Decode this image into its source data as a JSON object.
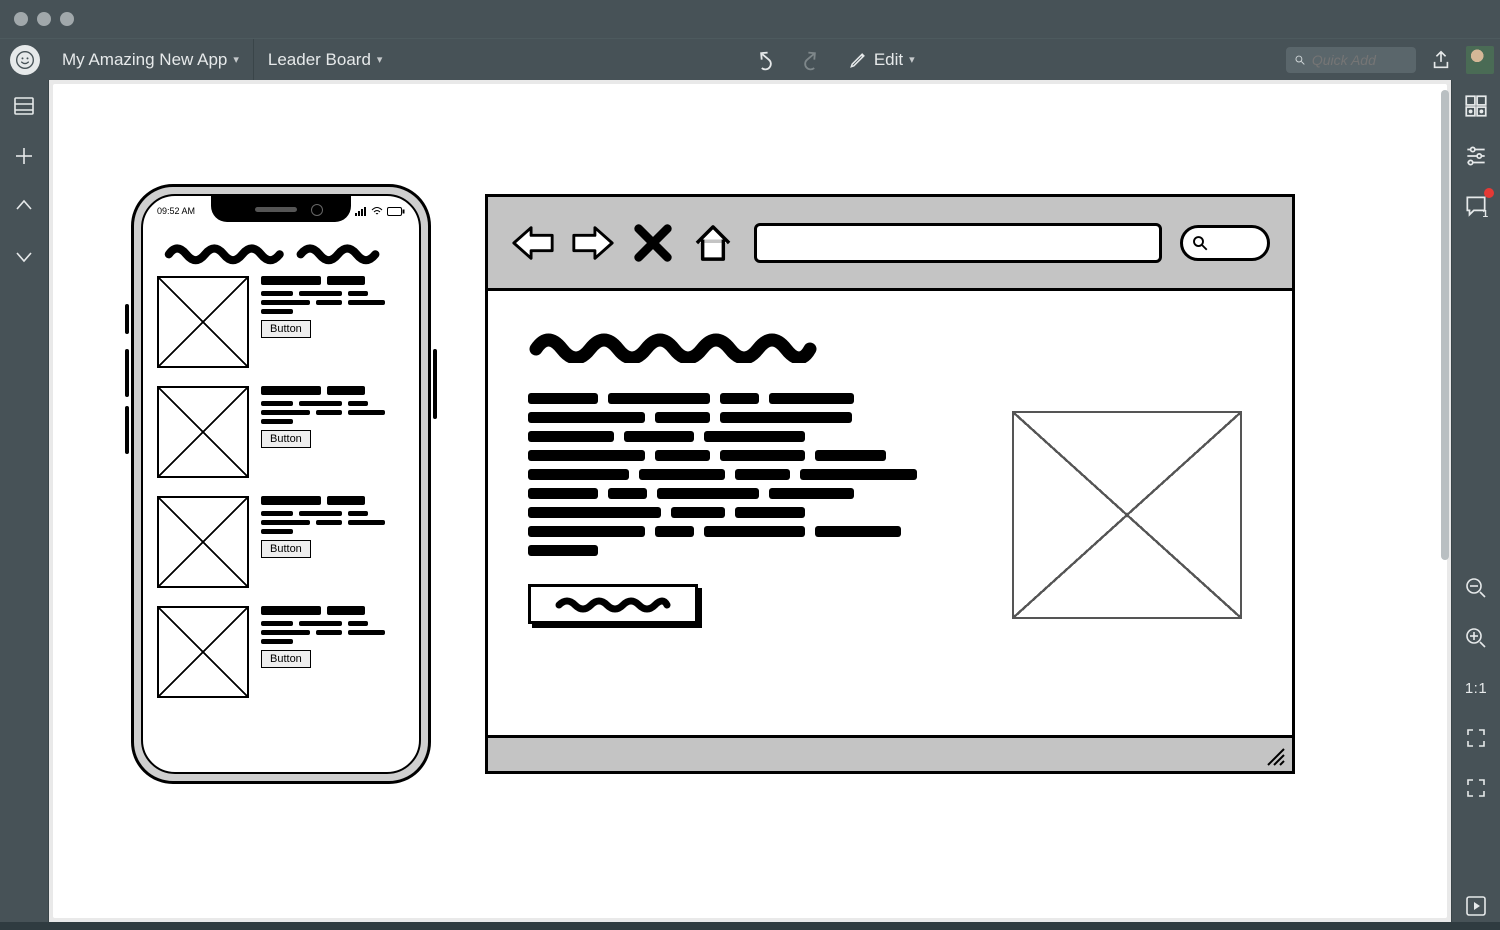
{
  "toolbar": {
    "project_name": "My Amazing New App",
    "page_name": "Leader Board",
    "edit_label": "Edit",
    "search_placeholder": "Quick Add"
  },
  "phone": {
    "time": "09:52 AM",
    "button_label": "Button"
  },
  "right_rail": {
    "zoom_reset_label": "1:1",
    "comments_count": "1"
  }
}
